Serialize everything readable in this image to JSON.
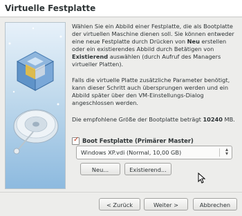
{
  "window": {
    "title": "Virtuelle Festplatte"
  },
  "description": {
    "p1_part1": "Wählen Sie ein Abbild einer Festplatte, die als Bootplatte der virtuellen Maschine dienen soll. Sie können entweder eine neue Festplatte durch Drücken von ",
    "p1_bold1": "Neu",
    "p1_part2": " erstellen oder ein existierendes Abbild durch Betätigen von ",
    "p1_bold2": "Existierend",
    "p1_part3": " auswählen (durch Aufruf des Managers virtueller Platten).",
    "p2": "Falls die virtuelle Platte zusätzliche Parameter benötigt, kann dieser Schritt auch übersprungen werden und ein Abbild später über den VM-Einstellungs-Dialog angeschlossen werden.",
    "p3_part1": "Die empfohlene Größe der Bootplatte beträgt ",
    "p3_bold": "10240",
    "p3_part2": " MB."
  },
  "boot_checkbox": {
    "label": "Boot Festplatte (Primärer Master)",
    "checked": true
  },
  "disk_select": {
    "value": "Windows XP.vdi (Normal, 10,00 GB)"
  },
  "buttons": {
    "new": "Neu...",
    "existing": "Existierend...",
    "back": "< Zurück",
    "next": "Weiter >",
    "cancel": "Abbrechen"
  },
  "colors": {
    "checkbox_mark": "#c0391b",
    "image_gradient_top": "#e7f1fa",
    "image_gradient_bottom": "#8dbadf"
  }
}
